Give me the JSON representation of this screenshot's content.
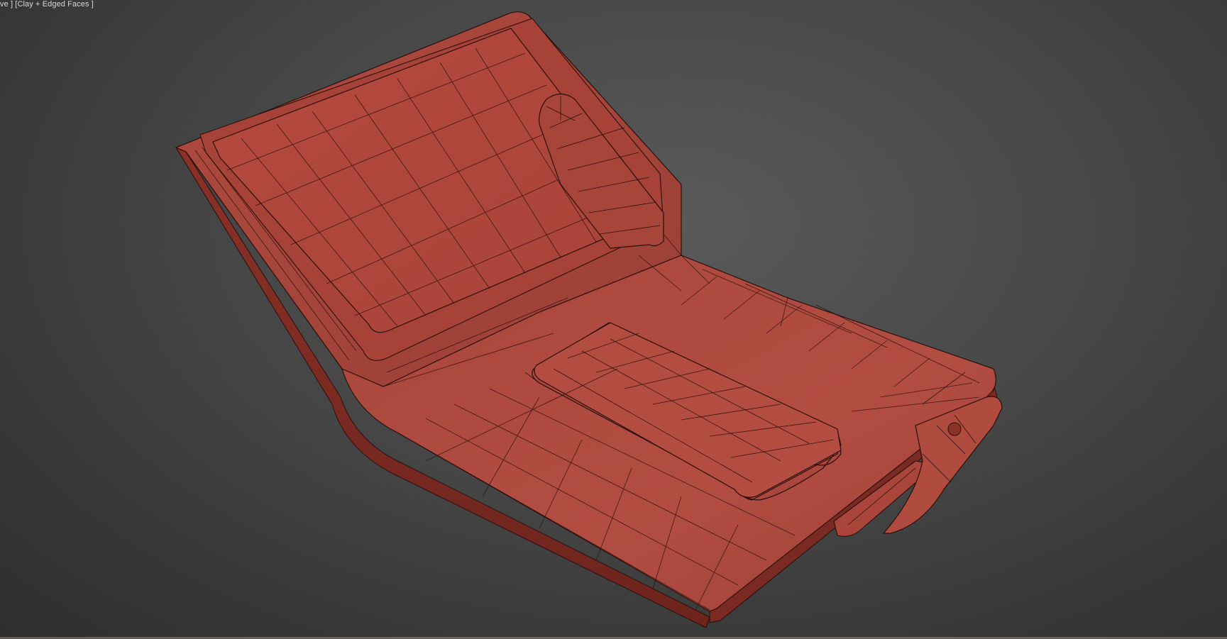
{
  "viewport": {
    "label_prefix": "ve ]",
    "label_shading": "[Clay + Edged Faces ]",
    "background_color": "#3a3a3a",
    "model_color": "#a8463c",
    "wire_color": "#2a0f0c"
  },
  "scene": {
    "object": "wallet-model",
    "display_mode": "clay-edged-faces"
  }
}
